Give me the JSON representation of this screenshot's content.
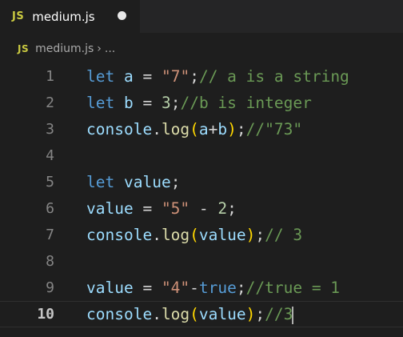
{
  "tab": {
    "icon": "JS",
    "title": "medium.js",
    "dirty_indicator": "unsaved-dot"
  },
  "breadcrumb": {
    "icon": "JS",
    "file": "medium.js",
    "separator": "›",
    "more": "..."
  },
  "editor": {
    "active_line": 10,
    "lines": [
      {
        "number": "1",
        "tokens": [
          {
            "t": "let",
            "c": "kw"
          },
          {
            "t": " ",
            "c": "op"
          },
          {
            "t": "a",
            "c": "var"
          },
          {
            "t": " = ",
            "c": "op"
          },
          {
            "t": "\"7\"",
            "c": "str"
          },
          {
            "t": ";",
            "c": "op"
          },
          {
            "t": "// a is a string",
            "c": "cm"
          }
        ]
      },
      {
        "number": "2",
        "tokens": [
          {
            "t": "let",
            "c": "kw"
          },
          {
            "t": " ",
            "c": "op"
          },
          {
            "t": "b",
            "c": "var"
          },
          {
            "t": " = ",
            "c": "op"
          },
          {
            "t": "3",
            "c": "num"
          },
          {
            "t": ";",
            "c": "op"
          },
          {
            "t": "//b is integer",
            "c": "cm"
          }
        ]
      },
      {
        "number": "3",
        "tokens": [
          {
            "t": "console",
            "c": "var"
          },
          {
            "t": ".",
            "c": "op"
          },
          {
            "t": "log",
            "c": "fn"
          },
          {
            "t": "(",
            "c": "br1"
          },
          {
            "t": "a",
            "c": "var"
          },
          {
            "t": "+",
            "c": "op"
          },
          {
            "t": "b",
            "c": "var"
          },
          {
            "t": ")",
            "c": "br1"
          },
          {
            "t": ";",
            "c": "op"
          },
          {
            "t": "//\"73\"",
            "c": "cm"
          }
        ]
      },
      {
        "number": "4",
        "tokens": []
      },
      {
        "number": "5",
        "tokens": [
          {
            "t": "let",
            "c": "kw"
          },
          {
            "t": " ",
            "c": "op"
          },
          {
            "t": "value",
            "c": "var"
          },
          {
            "t": ";",
            "c": "op"
          }
        ]
      },
      {
        "number": "6",
        "tokens": [
          {
            "t": "value",
            "c": "var"
          },
          {
            "t": " = ",
            "c": "op"
          },
          {
            "t": "\"5\"",
            "c": "str"
          },
          {
            "t": " - ",
            "c": "op"
          },
          {
            "t": "2",
            "c": "num"
          },
          {
            "t": ";",
            "c": "op"
          }
        ]
      },
      {
        "number": "7",
        "tokens": [
          {
            "t": "console",
            "c": "var"
          },
          {
            "t": ".",
            "c": "op"
          },
          {
            "t": "log",
            "c": "fn"
          },
          {
            "t": "(",
            "c": "br1"
          },
          {
            "t": "value",
            "c": "var"
          },
          {
            "t": ")",
            "c": "br1"
          },
          {
            "t": ";",
            "c": "op"
          },
          {
            "t": "// 3",
            "c": "cm"
          }
        ]
      },
      {
        "number": "8",
        "tokens": []
      },
      {
        "number": "9",
        "tokens": [
          {
            "t": "value",
            "c": "var"
          },
          {
            "t": " = ",
            "c": "op"
          },
          {
            "t": "\"4\"",
            "c": "str"
          },
          {
            "t": "-",
            "c": "op"
          },
          {
            "t": "true",
            "c": "bool"
          },
          {
            "t": ";",
            "c": "op"
          },
          {
            "t": "//true = 1",
            "c": "cm"
          }
        ]
      },
      {
        "number": "10",
        "tokens": [
          {
            "t": "console",
            "c": "var"
          },
          {
            "t": ".",
            "c": "op"
          },
          {
            "t": "log",
            "c": "fn"
          },
          {
            "t": "(",
            "c": "br1"
          },
          {
            "t": "value",
            "c": "var"
          },
          {
            "t": ")",
            "c": "br1"
          },
          {
            "t": ";",
            "c": "op"
          },
          {
            "t": "//3",
            "c": "cm"
          }
        ]
      }
    ]
  },
  "colors": {
    "editor_bg": "#1e1e1e",
    "tabbar_bg": "#252526",
    "keyword": "#569cd6",
    "variable": "#9cdcfe",
    "string": "#ce9178",
    "number": "#b5cea8",
    "comment": "#6a9955",
    "function": "#dcdcaa",
    "bracket": "#ffd700",
    "js_icon": "#cbcb41"
  }
}
